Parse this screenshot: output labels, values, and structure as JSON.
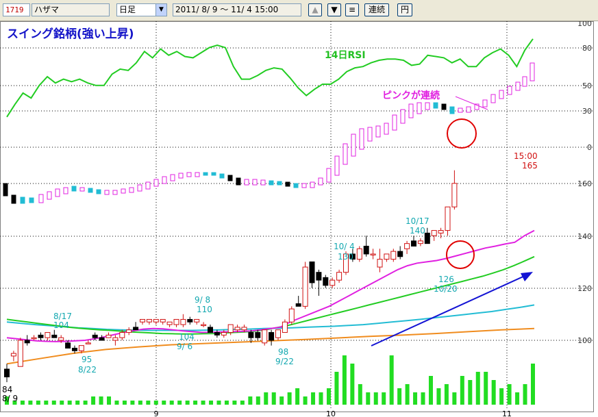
{
  "toolbar": {
    "code": "1719",
    "name": "ハザマ",
    "period": "日足",
    "date_range": "2011/ 8/ 9 〜 11/ 4 15:00",
    "up_icon": "▲",
    "down_icon": "▼",
    "menu_icon": "≡",
    "renzoku": "連続",
    "en": "円"
  },
  "chart": {
    "title": "スイング銘柄(強い上昇)",
    "rsi_label": "14日RSI",
    "pink_label": "ピンクが連続",
    "rsi_ticks": [
      "100",
      "80",
      "50",
      "30",
      "0"
    ],
    "price_ticks": [
      "160",
      "140",
      "120",
      "100"
    ],
    "date_ticks": [
      "9",
      "10",
      "11"
    ],
    "price_annotations": [
      {
        "lines": [
          "84"
        ],
        "color": "black"
      },
      {
        "lines": [
          "8/ 9"
        ],
        "color": "black"
      },
      {
        "lines": [
          "8/17",
          "104"
        ],
        "color": "teal"
      },
      {
        "lines": [
          "95",
          "8/22"
        ],
        "color": "teal"
      },
      {
        "lines": [
          "104",
          "9/ 6"
        ],
        "color": "teal"
      },
      {
        "lines": [
          "9/ 8",
          "110"
        ],
        "color": "teal"
      },
      {
        "lines": [
          "98",
          "9/22"
        ],
        "color": "teal"
      },
      {
        "lines": [
          "10/ 4",
          "130"
        ],
        "color": "teal"
      },
      {
        "lines": [
          "10/17",
          "140"
        ],
        "color": "teal"
      },
      {
        "lines": [
          "126",
          "10/20"
        ],
        "color": "teal"
      },
      {
        "lines": [
          "15:00",
          "165"
        ],
        "color": "red"
      }
    ]
  },
  "chart_data": {
    "type": "candlestick",
    "title": "スイング銘柄(強い上昇)",
    "x_ticks": [
      "9",
      "10",
      "11"
    ],
    "price_ylim": [
      82,
      172
    ],
    "candles": [
      {
        "o": 89,
        "h": 91,
        "l": 84,
        "c": 86
      },
      {
        "o": 94,
        "h": 96,
        "l": 92,
        "c": 95
      },
      {
        "o": 90,
        "h": 101,
        "l": 90,
        "c": 100
      },
      {
        "o": 100,
        "h": 102,
        "l": 98,
        "c": 99
      },
      {
        "o": 101,
        "h": 102,
        "l": 100,
        "c": 101
      },
      {
        "o": 102,
        "h": 103,
        "l": 100,
        "c": 101
      },
      {
        "o": 101,
        "h": 103,
        "l": 100,
        "c": 103
      },
      {
        "o": 102,
        "h": 104,
        "l": 101,
        "c": 101
      },
      {
        "o": 100,
        "h": 102,
        "l": 99,
        "c": 101
      },
      {
        "o": 99,
        "h": 100,
        "l": 97,
        "c": 97
      },
      {
        "o": 97,
        "h": 98,
        "l": 95,
        "c": 96
      },
      {
        "o": 96,
        "h": 98,
        "l": 95,
        "c": 98
      },
      {
        "o": 99,
        "h": 100,
        "l": 99,
        "c": 99
      },
      {
        "o": 102,
        "h": 103,
        "l": 100,
        "c": 101
      },
      {
        "o": 101,
        "h": 102,
        "l": 100,
        "c": 100
      },
      {
        "o": 101,
        "h": 103,
        "l": 101,
        "c": 102
      },
      {
        "o": 100,
        "h": 102,
        "l": 98,
        "c": 101
      },
      {
        "o": 101,
        "h": 104,
        "l": 100,
        "c": 103
      },
      {
        "o": 103,
        "h": 105,
        "l": 102,
        "c": 104
      },
      {
        "o": 105,
        "h": 107,
        "l": 104,
        "c": 104
      },
      {
        "o": 107,
        "h": 108,
        "l": 106,
        "c": 108
      },
      {
        "o": 107,
        "h": 108,
        "l": 106,
        "c": 108
      },
      {
        "o": 107,
        "h": 108,
        "l": 106,
        "c": 108
      },
      {
        "o": 107,
        "h": 108,
        "l": 106,
        "c": 108
      },
      {
        "o": 106,
        "h": 107,
        "l": 105,
        "c": 107
      },
      {
        "o": 106,
        "h": 108,
        "l": 105,
        "c": 108
      },
      {
        "o": 106,
        "h": 110,
        "l": 105,
        "c": 108
      },
      {
        "o": 108,
        "h": 109,
        "l": 106,
        "c": 107
      },
      {
        "o": 107,
        "h": 108,
        "l": 106,
        "c": 108
      },
      {
        "o": 106,
        "h": 107,
        "l": 105,
        "c": 106
      },
      {
        "o": 105,
        "h": 106,
        "l": 103,
        "c": 103
      },
      {
        "o": 103,
        "h": 104,
        "l": 101,
        "c": 102
      },
      {
        "o": 102,
        "h": 104,
        "l": 101,
        "c": 103
      },
      {
        "o": 103,
        "h": 106,
        "l": 102,
        "c": 106
      },
      {
        "o": 104,
        "h": 106,
        "l": 103,
        "c": 105
      },
      {
        "o": 104,
        "h": 106,
        "l": 103,
        "c": 105
      },
      {
        "o": 103,
        "h": 104,
        "l": 99,
        "c": 101
      },
      {
        "o": 103,
        "h": 104,
        "l": 100,
        "c": 101
      },
      {
        "o": 99,
        "h": 104,
        "l": 98,
        "c": 104
      },
      {
        "o": 103,
        "h": 104,
        "l": 98,
        "c": 100
      },
      {
        "o": 101,
        "h": 104,
        "l": 100,
        "c": 104
      },
      {
        "o": 103,
        "h": 108,
        "l": 103,
        "c": 107
      },
      {
        "o": 107,
        "h": 113,
        "l": 106,
        "c": 112
      },
      {
        "o": 114,
        "h": 117,
        "l": 113,
        "c": 113
      },
      {
        "o": 113,
        "h": 130,
        "l": 112,
        "c": 128
      },
      {
        "o": 130,
        "h": 130,
        "l": 120,
        "c": 122
      },
      {
        "o": 126,
        "h": 127,
        "l": 117,
        "c": 123
      },
      {
        "o": 124,
        "h": 125,
        "l": 120,
        "c": 121
      },
      {
        "o": 121,
        "h": 124,
        "l": 120,
        "c": 123
      },
      {
        "o": 123,
        "h": 127,
        "l": 122,
        "c": 126
      },
      {
        "o": 126,
        "h": 134,
        "l": 125,
        "c": 133
      },
      {
        "o": 133,
        "h": 135,
        "l": 130,
        "c": 131
      },
      {
        "o": 131,
        "h": 136,
        "l": 130,
        "c": 135
      },
      {
        "o": 136,
        "h": 140,
        "l": 132,
        "c": 133
      },
      {
        "o": 133,
        "h": 135,
        "l": 131,
        "c": 133
      },
      {
        "o": 128,
        "h": 135,
        "l": 126,
        "c": 131
      },
      {
        "o": 131,
        "h": 133,
        "l": 130,
        "c": 133
      },
      {
        "o": 131,
        "h": 135,
        "l": 130,
        "c": 134
      },
      {
        "o": 134,
        "h": 136,
        "l": 131,
        "c": 132
      },
      {
        "o": 135,
        "h": 138,
        "l": 133,
        "c": 137
      },
      {
        "o": 138,
        "h": 140,
        "l": 137,
        "c": 136
      },
      {
        "o": 137,
        "h": 139,
        "l": 136,
        "c": 138
      },
      {
        "o": 141,
        "h": 143,
        "l": 137,
        "c": 137
      },
      {
        "o": 140,
        "h": 142,
        "l": 138,
        "c": 142
      },
      {
        "o": 141,
        "h": 143,
        "l": 139,
        "c": 142
      },
      {
        "o": 142,
        "h": 151,
        "l": 140,
        "c": 151
      },
      {
        "o": 151,
        "h": 165,
        "l": 150,
        "c": 160
      }
    ],
    "ma_pink": [
      101,
      100.6,
      100.2,
      99.8,
      99.6,
      99.5,
      99.6,
      99.8,
      100,
      100.6,
      101.3,
      102.2,
      103,
      103.7,
      104.3,
      104.5,
      104.4,
      104,
      103.6,
      103.3,
      103,
      103.1,
      103.2,
      103.3,
      103.4,
      103.6,
      104,
      104.5,
      105,
      107,
      108.5,
      110,
      111.5,
      113,
      115,
      117,
      119,
      121,
      123,
      125,
      127,
      128.5,
      129.5,
      130,
      130.5,
      131.3,
      132.3,
      133.3,
      134.3,
      135.3,
      136,
      136.8,
      137.5,
      140,
      142
    ],
    "ma_green": [
      108,
      107.5,
      107,
      106.5,
      106,
      105.5,
      105,
      104.6,
      104.3,
      104,
      103.8,
      103.5,
      103.2,
      103,
      102.8,
      102.6,
      102.5,
      102.4,
      102.4,
      102.5,
      102.6,
      102.8,
      103,
      103.2,
      103.5,
      104,
      104.8,
      105.5,
      106.5,
      107.5,
      108.5,
      109.5,
      110.5,
      111.5,
      112.5,
      113.5,
      114.5,
      115.5,
      116.5,
      117.5,
      118.5,
      119.5,
      120.5,
      121.5,
      122.5,
      123.5,
      124.5,
      125.7,
      127,
      128.5,
      130.2,
      132
    ],
    "ma_cyan": [
      107,
      106.5,
      106,
      105.6,
      105.2,
      104.8,
      104.5,
      104.2,
      104,
      103.9,
      103.8,
      103.8,
      103.8,
      103.8,
      103.9,
      104,
      104.2,
      104.3,
      104.5,
      104.6,
      104.8,
      105,
      105.2,
      105.4,
      105.7,
      106,
      106.5,
      107,
      107.5,
      108,
      108.6,
      109.2,
      109.8,
      110.4,
      111,
      111.8,
      112.6,
      113.5
    ],
    "ma_orange": [
      91,
      93,
      95,
      96.5,
      97.5,
      98.3,
      98.8,
      99.3,
      99.8,
      100.3,
      100.9,
      101.5,
      102,
      102.6,
      103.3,
      104,
      104.5
    ],
    "rsi": [
      24,
      34,
      43,
      39,
      49,
      56,
      51,
      54,
      52,
      54,
      51,
      49,
      49,
      58,
      62,
      61,
      67,
      76,
      71,
      78,
      73,
      76,
      72,
      71,
      75,
      79,
      81,
      79,
      64,
      54,
      54,
      57,
      61,
      63,
      62,
      55,
      47,
      41,
      46,
      50,
      50,
      54,
      60,
      63,
      64,
      67,
      69,
      70,
      70,
      69,
      65,
      66,
      73,
      72,
      71,
      67,
      70,
      64,
      64,
      71,
      75,
      78,
      73,
      64,
      77,
      86
    ],
    "rsi_ylim": [
      0,
      100
    ],
    "volume": [
      2,
      1,
      1,
      1,
      1,
      1,
      1,
      1,
      1,
      1,
      1,
      2,
      2,
      2,
      1,
      1,
      1,
      1,
      1,
      1,
      1,
      1,
      1,
      1,
      1,
      1,
      1,
      1,
      1,
      1,
      1,
      2,
      2,
      3,
      3,
      2,
      3,
      4,
      2,
      3,
      3,
      4,
      8,
      12,
      10,
      5,
      3,
      3,
      3,
      12,
      4,
      5,
      3,
      3,
      7,
      4,
      5,
      3,
      7,
      6,
      8,
      8,
      6,
      4,
      5,
      3,
      5,
      10
    ]
  }
}
